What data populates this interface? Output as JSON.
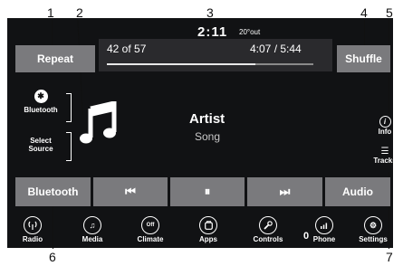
{
  "callouts": [
    "1",
    "2",
    "3",
    "4",
    "5",
    "6",
    "7"
  ],
  "status": {
    "time": "2:11",
    "outside_temp": "20°out"
  },
  "top_bar": {
    "repeat_label": "Repeat",
    "shuffle_label": "Shuffle",
    "track_counter": "42 of 57",
    "elapsed_total": "4:07 / 5:44",
    "progress": 0.72
  },
  "source": {
    "bluetooth_label": "Bluetooth",
    "select_source_line1": "Select",
    "select_source_line2": "Source"
  },
  "now_playing": {
    "artist": "Artist",
    "song": "Song"
  },
  "right_panel": {
    "info_label": "Info",
    "tracks_label": "Tracks"
  },
  "controls": {
    "source_button_label": "Bluetooth",
    "audio_button_label": "Audio"
  },
  "nav": [
    {
      "label": "Radio",
      "icon": "radio-icon"
    },
    {
      "label": "Media",
      "icon": "media-icon"
    },
    {
      "label": "Climate",
      "icon": "climate-icon",
      "glyph": "Off"
    },
    {
      "label": "Apps",
      "icon": "apps-icon"
    },
    {
      "label": "Controls",
      "icon": "controls-icon"
    },
    {
      "label": "Phone",
      "icon": "phone-icon",
      "badge": "0"
    },
    {
      "label": "Settings",
      "icon": "settings-icon"
    }
  ],
  "colors": {
    "screen_bg": "#111214",
    "button_gray": "#7a7a7d"
  }
}
